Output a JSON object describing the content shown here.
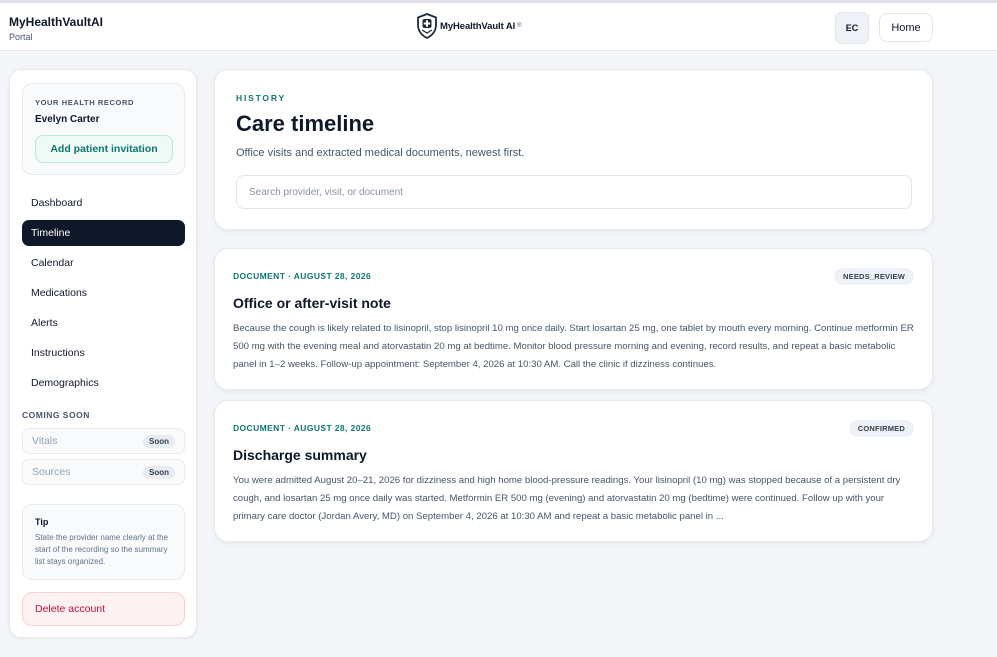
{
  "header": {
    "brand_name": "MyHealthVaultAI",
    "brand_sub": "Portal",
    "logo_text": "MyHealthVault AI",
    "logo_sup": "®",
    "avatar_initials": "EC",
    "home_label": "Home"
  },
  "sidebar": {
    "record_kicker": "YOUR HEALTH RECORD",
    "patient_name": "Evelyn Carter",
    "invite_label": "Add patient invitation",
    "nav": [
      {
        "label": "Dashboard"
      },
      {
        "label": "Timeline"
      },
      {
        "label": "Calendar"
      },
      {
        "label": "Medications"
      },
      {
        "label": "Alerts"
      },
      {
        "label": "Instructions"
      },
      {
        "label": "Demographics"
      }
    ],
    "active_nav": "Timeline",
    "coming_soon_heading": "COMING SOON",
    "coming_soon": [
      {
        "label": "Vitals",
        "badge": "Soon"
      },
      {
        "label": "Sources",
        "badge": "Soon"
      }
    ],
    "tip_title": "Tip",
    "tip_text": "State the provider name clearly at the start of the recording so the summary list stays organized.",
    "delete_label": "Delete account"
  },
  "main": {
    "kicker": "HISTORY",
    "title": "Care timeline",
    "description": "Office visits and extracted medical documents, newest first.",
    "search_placeholder": "Search provider, visit, or document",
    "search_value": "",
    "documents": [
      {
        "meta": "DOCUMENT · AUGUST 28, 2026",
        "status": "NEEDS_REVIEW",
        "title": "Office or after-visit note",
        "text": "Because the cough is likely related to lisinopril, stop lisinopril 10 mg once daily. Start losartan 25 mg, one tablet by mouth every morning. Continue metformin ER 500 mg with the evening meal and atorvastatin 20 mg at bedtime. Monitor blood pressure morning and evening, record results, and repeat a basic metabolic panel in 1–2 weeks. Follow-up appointment: September 4, 2026 at 10:30 AM. Call the clinic if dizziness continues."
      },
      {
        "meta": "DOCUMENT · AUGUST 28, 2026",
        "status": "CONFIRMED",
        "title": "Discharge summary",
        "text": "You were admitted August 20–21, 2026 for dizziness and high home blood-pressure readings. Your lisinopril (10 mg) was stopped because of a persistent dry cough, and losartan 25 mg once daily was started. Metformin ER 500 mg (evening) and atorvastatin 20 mg (bedtime) were continued. Follow up with your primary care doctor (Jordan Avery, MD) on September 4, 2026 at 10:30 AM and repeat a basic metabolic panel in ..."
      }
    ]
  },
  "colors": {
    "accent_teal": "#0f766e",
    "nav_active_bg": "#0f172a",
    "danger": "#be123c"
  },
  "icons": {
    "logo": "shield-medical-cross-icon"
  }
}
